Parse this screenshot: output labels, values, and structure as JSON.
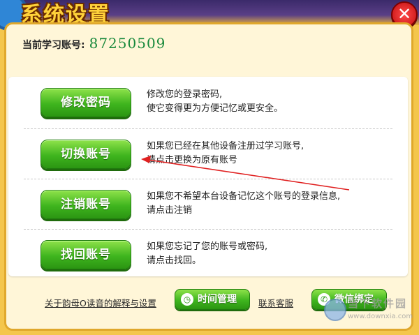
{
  "window": {
    "title": "系统设置",
    "close_glyph": "✕"
  },
  "account": {
    "label": "当前学习账号:",
    "value": "87250509"
  },
  "options": [
    {
      "button": "修改密码",
      "desc_line1": "修改您的登录密码,",
      "desc_line2": "使它变得更为方便记忆或更安全。"
    },
    {
      "button": "切换账号",
      "desc_line1": "如果您已经在其他设备注册过学习账号,",
      "desc_line2": "请点击更换为原有账号"
    },
    {
      "button": "注销账号",
      "desc_line1": "如果您不希望本台设备记忆这个账号的登录信息,",
      "desc_line2": "请点击注销"
    },
    {
      "button": "找回账号",
      "desc_line1": "如果您忘记了您的账号或密码,",
      "desc_line2": "请点击找回。"
    }
  ],
  "footer": {
    "explain_link": "关于韵母O读音的解释与设置",
    "time_button": "时间管理",
    "time_icon": "clock-icon",
    "service_link": "联系客服",
    "wechat_button": "微信绑定",
    "wechat_icon": "wechat-icon"
  },
  "watermark": {
    "name": "当下软件园",
    "url": "www.downxia.com"
  },
  "colors": {
    "button_green": "#3fb51e",
    "account_green": "#16883a",
    "annotation_red": "#e02020"
  }
}
